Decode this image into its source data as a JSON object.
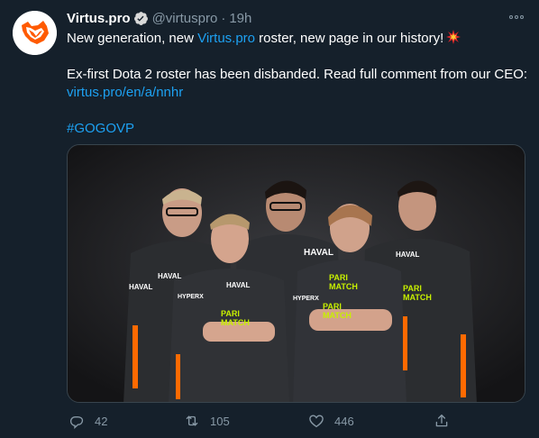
{
  "tweet": {
    "author": {
      "name": "Virtus.pro",
      "handle": "@virtuspro",
      "separator": "·",
      "time": "19h",
      "avatar_icon": "virtuspro-bear-logo",
      "verified_icon": "verified-badge"
    },
    "text": {
      "line1_prefix": "New generation, new ",
      "line1_link": "Virtus.pro",
      "line1_suffix": " roster, new page in our history!",
      "line1_emoji": "collision-emoji",
      "line2": "Ex-first Dota 2 roster has been disbanded. Read full comment from our CEO:",
      "line3_link": "virtus.pro/en/a/nnhr",
      "hashtag": "#GOGOVP"
    },
    "media": {
      "description_icon": "team-photo",
      "jersey_sponsors": [
        "HYPERX",
        "HAVAL",
        "PARI MATCH"
      ]
    },
    "actions": {
      "replies": "42",
      "retweets": "105",
      "likes": "446"
    },
    "colors": {
      "background": "#15202b",
      "link": "#1da1f2",
      "muted": "#8899a6",
      "accent": "#ff6a00",
      "sponsor": "#c8f000"
    }
  }
}
